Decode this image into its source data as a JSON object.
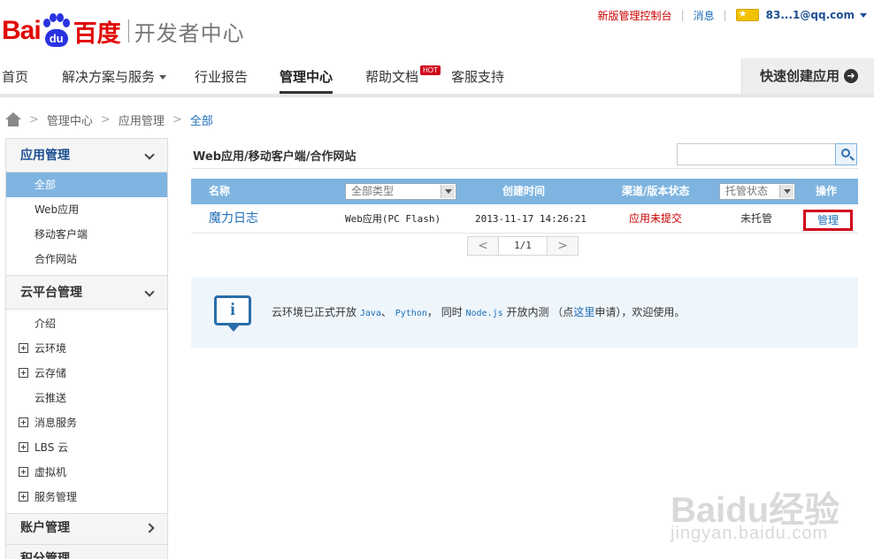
{
  "header": {
    "logo_bai": "Bai",
    "logo_du": "du",
    "logo_cn": "百度",
    "logo_sub": "开发者中心",
    "top_links": {
      "new_console": "新版管理控制台",
      "messages": "消息",
      "user": "83...1@qq.com"
    }
  },
  "nav": {
    "items": [
      "首页",
      "解决方案与服务",
      "行业报告",
      "管理中心",
      "帮助文档",
      "客服支持"
    ],
    "active_index": 3,
    "hot_badge": "HOT",
    "quick_create": "快速创建应用"
  },
  "breadcrumb": [
    "管理中心",
    "应用管理",
    "全部"
  ],
  "sidebar": {
    "app_mgmt": {
      "title": "应用管理",
      "items": [
        "全部",
        "Web应用",
        "移动客户端",
        "合作网站"
      ],
      "active_index": 0
    },
    "cloud_mgmt": {
      "title": "云平台管理",
      "items": [
        {
          "label": "介绍",
          "expandable": false
        },
        {
          "label": "云环境",
          "expandable": true
        },
        {
          "label": "云存储",
          "expandable": true
        },
        {
          "label": "云推送",
          "expandable": false
        },
        {
          "label": "消息服务",
          "expandable": true
        },
        {
          "label": "LBS 云",
          "expandable": true
        },
        {
          "label": "虚拟机",
          "expandable": true
        },
        {
          "label": "服务管理",
          "expandable": true
        }
      ]
    },
    "account_mgmt": "账户管理",
    "points_mgmt": "积分管理"
  },
  "main": {
    "title": "Web应用/移动客户端/合作网站",
    "search": {
      "value": "",
      "placeholder": ""
    },
    "table": {
      "headers": {
        "name": "名称",
        "type_select": "全部类型",
        "created": "创建时间",
        "status": "渠道/版本状态",
        "hosting_select": "托管状态",
        "action": "操作"
      },
      "rows": [
        {
          "name": "魔力日志",
          "type": "Web应用(PC Flash)",
          "created": "2013-11-17 14:26:21",
          "status": "应用未提交",
          "hosting": "未托管",
          "action": "管理"
        }
      ]
    },
    "pager": {
      "prev": "<",
      "page": "1/1",
      "next": ">"
    },
    "notice": {
      "t1": "云环境已正式开放 ",
      "java": "Java",
      "t2": "、 ",
      "python": "Python",
      "t3": "， 同时 ",
      "node": "Node.js",
      "t4": " 开放内测 （点",
      "link": "这里",
      "t5": "申请），欢迎使用。"
    }
  },
  "watermark": {
    "main": "Baidu经验",
    "url": "jingyan.baidu.com"
  },
  "colors": {
    "brand_red": "#e10602",
    "brand_blue": "#2932e1",
    "table_header": "#7fb4e0",
    "link": "#1d6fb8"
  }
}
